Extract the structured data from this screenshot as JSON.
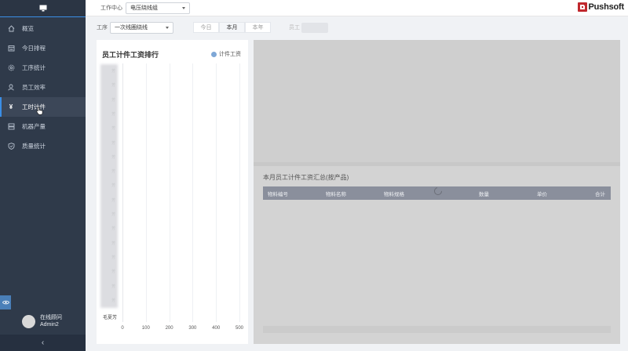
{
  "sidebar": {
    "items": [
      {
        "label": "概览",
        "icon": "home-icon",
        "active": false
      },
      {
        "label": "今日排程",
        "icon": "calendar-icon",
        "active": false
      },
      {
        "label": "工序统计",
        "icon": "gear-icon",
        "active": false
      },
      {
        "label": "员工效率",
        "icon": "user-icon",
        "active": false
      },
      {
        "label": "工时计件",
        "icon": "yen-icon",
        "active": true
      },
      {
        "label": "机器产量",
        "icon": "server-icon",
        "active": false
      },
      {
        "label": "质量统计",
        "icon": "shield-check-icon",
        "active": false
      }
    ],
    "user": {
      "line1": "在线顾问",
      "line2": "Admin2"
    },
    "collapse_glyph": "‹"
  },
  "topbar": {
    "label": "工作中心",
    "select_value": "电压绕线组",
    "logo_text": "Pushsoft"
  },
  "filter": {
    "process_label": "工序",
    "process_value": "一次线圈绕线",
    "periods": [
      "今日",
      "本月",
      "本年"
    ],
    "active_period": "本月",
    "employee_label": "员工"
  },
  "left_panel": {
    "title": "员工计件工资排行",
    "legend": "计件工资",
    "last_name": "毛夏芳",
    "name_suffixes": [
      "芳",
      "芳",
      "芳",
      "芳",
      "芳",
      "芳",
      "芳",
      "芳",
      "芳",
      "芳",
      "芳",
      "芳",
      "芳",
      "芳",
      "芳",
      "芳",
      "芳"
    ],
    "xticks": [
      "0",
      "100",
      "200",
      "300",
      "400",
      "500"
    ]
  },
  "chart_data": {
    "type": "bar",
    "title": "员工计件工资排行",
    "legend": [
      "计件工资"
    ],
    "xlim": [
      0,
      500
    ],
    "xticks": [
      "0",
      "100",
      "200",
      "300",
      "400",
      "500"
    ],
    "series": [
      {
        "name": "计件工资",
        "values": []
      }
    ]
  },
  "right_panel": {
    "summary_title": "本月员工计件工资汇总(按产品)",
    "columns": [
      "物料编号",
      "物料名称",
      "物料规格",
      "数量",
      "单价",
      "合计"
    ]
  },
  "colors": {
    "sidebar_bg": "#2f3a4a",
    "accent": "#3a8ee6",
    "legend": "#7ea7d6",
    "logo_red": "#c0282d",
    "table_header": "#8a8f9c"
  }
}
